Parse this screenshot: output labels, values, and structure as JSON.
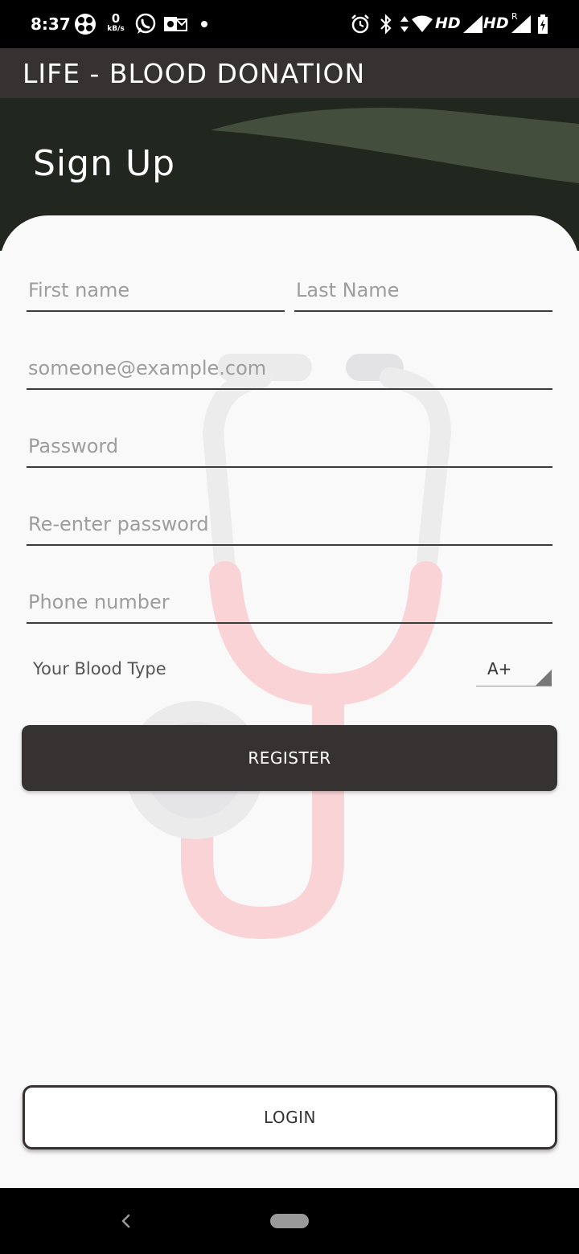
{
  "status_bar": {
    "time": "8:37",
    "data_rate_value": "0",
    "data_rate_unit": "kB/s",
    "network_1": "HD",
    "network_2": "HD",
    "roaming": "R",
    "icons": [
      "fan-icon",
      "whatsapp-icon",
      "outlook-icon",
      "alarm-icon",
      "bluetooth-icon",
      "data-arrows-icon",
      "wifi-icon",
      "signal-icon",
      "signal-icon",
      "battery-charging-icon"
    ]
  },
  "app_bar": {
    "title": "LIFE - BLOOD DONATION"
  },
  "header": {
    "title": "Sign Up"
  },
  "form": {
    "first_name_placeholder": "First name",
    "last_name_placeholder": "Last Name",
    "email_placeholder": "someone@example.com",
    "password_placeholder": "Password",
    "reenter_password_placeholder": "Re-enter password",
    "phone_placeholder": "Phone number",
    "blood_type_label": "Your Blood Type",
    "blood_type_value": "A+",
    "register_label": "REGISTER",
    "login_label": "LOGIN"
  },
  "colors": {
    "app_bar": "#373232",
    "header_bg": "#21261f",
    "header_wave": "#434e3c",
    "card_bg": "#f9f9f9",
    "button_dark": "#373232",
    "watermark_red": "#f9d3d6",
    "watermark_gray": "#ebebeb"
  },
  "nav_bar": {
    "icons": [
      "back-icon",
      "home-pill-icon"
    ]
  }
}
